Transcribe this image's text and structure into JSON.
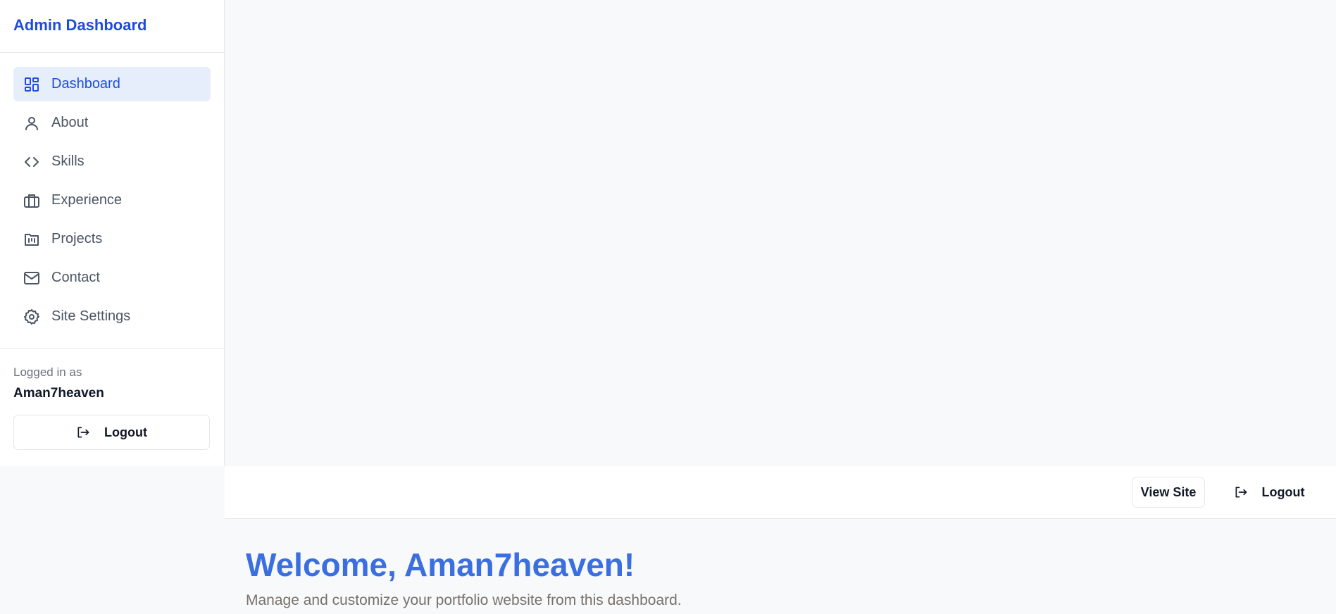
{
  "sidebar": {
    "title": "Admin Dashboard",
    "nav": [
      {
        "label": "Dashboard",
        "icon": "dashboard-icon",
        "active": true
      },
      {
        "label": "About",
        "icon": "user-icon"
      },
      {
        "label": "Skills",
        "icon": "code-icon"
      },
      {
        "label": "Experience",
        "icon": "briefcase-icon"
      },
      {
        "label": "Projects",
        "icon": "folder-icon"
      },
      {
        "label": "Contact",
        "icon": "mail-icon"
      },
      {
        "label": "Site Settings",
        "icon": "gear-icon"
      }
    ],
    "logged_in_label": "Logged in as",
    "username": "Aman7heaven",
    "logout_label": "Logout"
  },
  "topbar": {
    "view_site_label": "View Site",
    "logout_label": "Logout"
  },
  "main": {
    "welcome": "Welcome, Aman7heaven!",
    "subtitle": "Manage and customize your portfolio website from this dashboard."
  },
  "colors": {
    "accent": "#1d4ed8",
    "active_bg": "#e6eefc",
    "welcome": "#3b6fe0"
  }
}
